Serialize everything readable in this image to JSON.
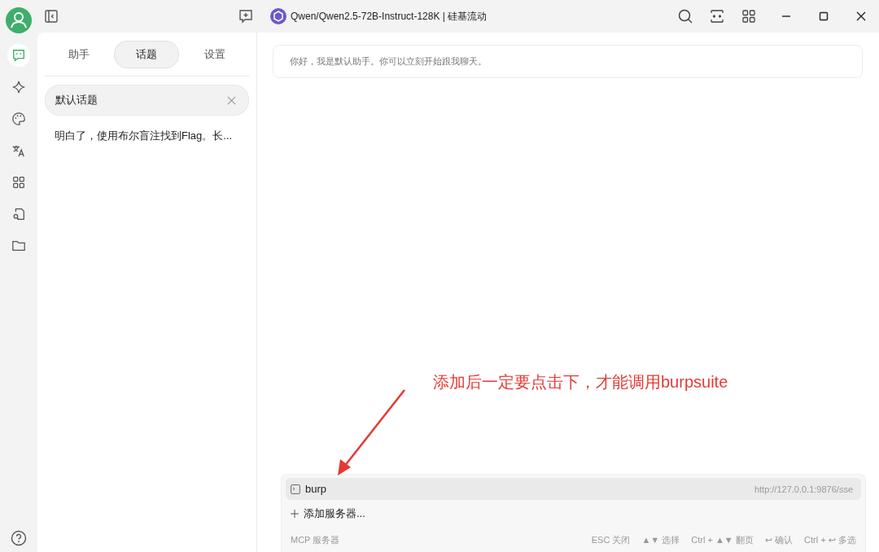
{
  "rail": {
    "items": [
      {
        "kind": "chat",
        "selected": true
      },
      {
        "kind": "sparkle",
        "selected": false
      },
      {
        "kind": "palette",
        "selected": false
      },
      {
        "kind": "translate",
        "selected": false
      },
      {
        "kind": "apps",
        "selected": false
      },
      {
        "kind": "docsearch",
        "selected": false
      },
      {
        "kind": "folder",
        "selected": false
      }
    ]
  },
  "titlebar": {
    "model": "Qwen/Qwen2.5-72B-Instruct-128K | 硅基流动"
  },
  "sidebar": {
    "tabs": [
      {
        "label": "助手",
        "selected": false
      },
      {
        "label": "话题",
        "selected": true
      },
      {
        "label": "设置",
        "selected": false
      }
    ],
    "topics": [
      {
        "title": "默认话题",
        "selected": true
      },
      {
        "title": "明白了，使用布尔盲注找到Flag。长...",
        "selected": false
      }
    ]
  },
  "chat": {
    "greeting": "你好，我是默认助手。你可以立刻开始跟我聊天。"
  },
  "annotation": {
    "text": "添加后一定要点击下，才能调用burpsuite"
  },
  "mcp_panel": {
    "servers": [
      {
        "name": "burp",
        "url": "http://127.0.0.1:9876/sse",
        "selected": true
      }
    ],
    "add_label": "添加服务器...",
    "footer_title": "MCP 服务器",
    "hints": [
      "ESC 关闭",
      "▲▼ 选择",
      "Ctrl + ▲▼ 翻页",
      "↩ 确认",
      "Ctrl + ↩ 多选"
    ]
  }
}
